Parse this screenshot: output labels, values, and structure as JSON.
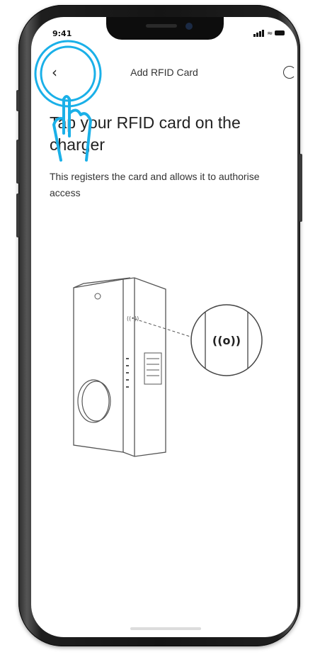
{
  "status_bar": {
    "time": "9:41"
  },
  "header": {
    "title": "Add RFID Card",
    "back_icon": "chevron-left-icon",
    "right_icon": "refresh-icon"
  },
  "main": {
    "heading": "Tap your RFID card on the charger",
    "description": "This registers the card and allows it to authorise access",
    "illustration": {
      "rfid_symbol": "((o))"
    }
  },
  "colors": {
    "tap_highlight": "#1ab0e8",
    "text": "#222222",
    "phone_frame": "#151515"
  }
}
